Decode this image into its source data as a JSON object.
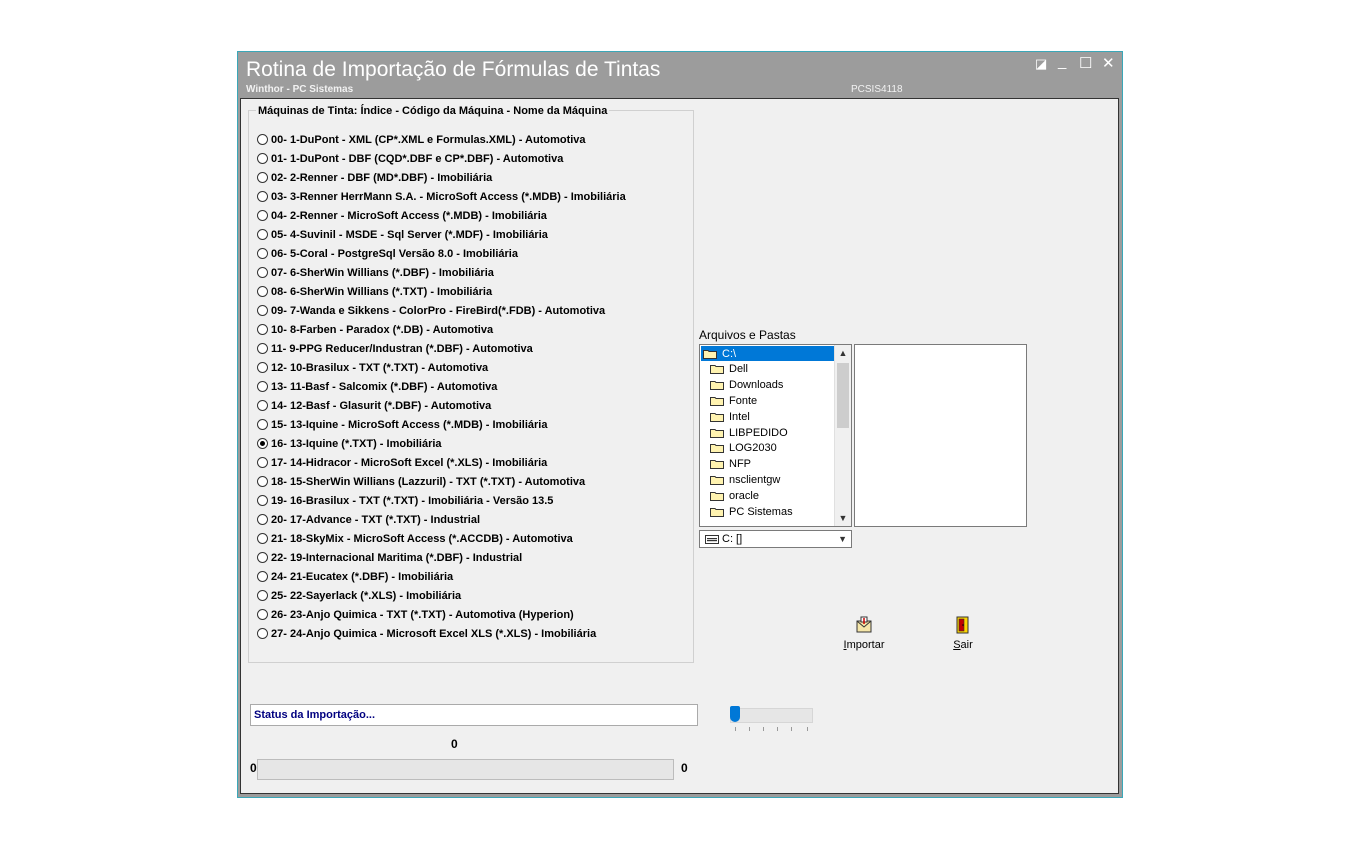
{
  "window": {
    "title": "Rotina de Importação de Fórmulas de Tintas",
    "subtitle": "Winthor - PC Sistemas",
    "code": "PCSIS4118",
    "controls": {
      "restore": "◪",
      "minimize": "_",
      "maximize": "☐",
      "close": "✕"
    }
  },
  "machines": {
    "legend": "Máquinas de Tinta: Índice - Código da Máquina - Nome da Máquina",
    "selected_index": 16,
    "options": [
      "00-  1-DuPont - XML (CP*.XML  e  Formulas.XML) - Automotiva",
      "01-  1-DuPont - DBF (CQD*.DBF  e  CP*.DBF) - Automotiva",
      "02-  2-Renner - DBF (MD*.DBF) - Imobiliária",
      "03-  3-Renner HerrMann S.A. - MicroSoft Access (*.MDB) - Imobiliária",
      "04-  2-Renner - MicroSoft Access (*.MDB) - Imobiliária",
      "05-  4-Suvinil - MSDE - Sql Server (*.MDF) - Imobiliária",
      "06-  5-Coral - PostgreSql Versão 8.0 - Imobiliária",
      "07-  6-SherWin Willians (*.DBF) - Imobiliária",
      "08-  6-SherWin Willians (*.TXT) - Imobiliária",
      "09-  7-Wanda e Sikkens - ColorPro - FireBird(*.FDB) - Automotiva",
      "10-  8-Farben - Paradox (*.DB) - Automotiva",
      "11-  9-PPG Reducer/Industran (*.DBF) - Automotiva",
      "12- 10-Brasilux - TXT (*.TXT) - Automotiva",
      "13- 11-Basf - Salcomix (*.DBF) - Automotiva",
      "14- 12-Basf - Glasurit (*.DBF) - Automotiva",
      "15- 13-Iquine - MicroSoft Access (*.MDB) - Imobiliária",
      "16- 13-Iquine (*.TXT) - Imobiliária",
      "17- 14-Hidracor - MicroSoft Excel (*.XLS) - Imobiliária",
      "18- 15-SherWin Willians (Lazzuril) - TXT (*.TXT) - Automotiva",
      "19- 16-Brasilux - TXT (*.TXT) - Imobiliária - Versão 13.5",
      "20- 17-Advance - TXT (*.TXT) - Industrial",
      "21- 18-SkyMix - MicroSoft Access (*.ACCDB) - Automotiva",
      "22- 19-Internacional Maritima (*.DBF) - Industrial",
      "24- 21-Eucatex (*.DBF) - Imobiliária",
      "25- 22-Sayerlack (*.XLS) - Imobiliária",
      "26- 23-Anjo Quimica - TXT (*.TXT) - Automotiva (Hyperion)",
      "27- 24-Anjo Quimica - Microsoft Excel XLS (*.XLS) - Imobiliária"
    ]
  },
  "files": {
    "label": "Arquivos e Pastas",
    "folders": [
      "C:\\",
      "Dell",
      "Downloads",
      "Fonte",
      "Intel",
      "LIBPEDIDO",
      "LOG2030",
      "NFP",
      "nsclientgw",
      "oracle",
      "PC Sistemas"
    ],
    "drive": "C: []"
  },
  "buttons": {
    "import_label": "Importar",
    "import_hotkey": "I",
    "import_rest": "mportar",
    "exit_hotkey": "S",
    "exit_rest": "air"
  },
  "status": {
    "text": "Status da Importação...",
    "counter": "0",
    "progress_min": "0",
    "progress_max": "0",
    "progress_value": 0,
    "slider_value": 0
  },
  "colors": {
    "window_frame": "#9c9c9c",
    "client_bg": "#f0f0f0",
    "selection": "#0078d7",
    "status_text": "#000080"
  }
}
